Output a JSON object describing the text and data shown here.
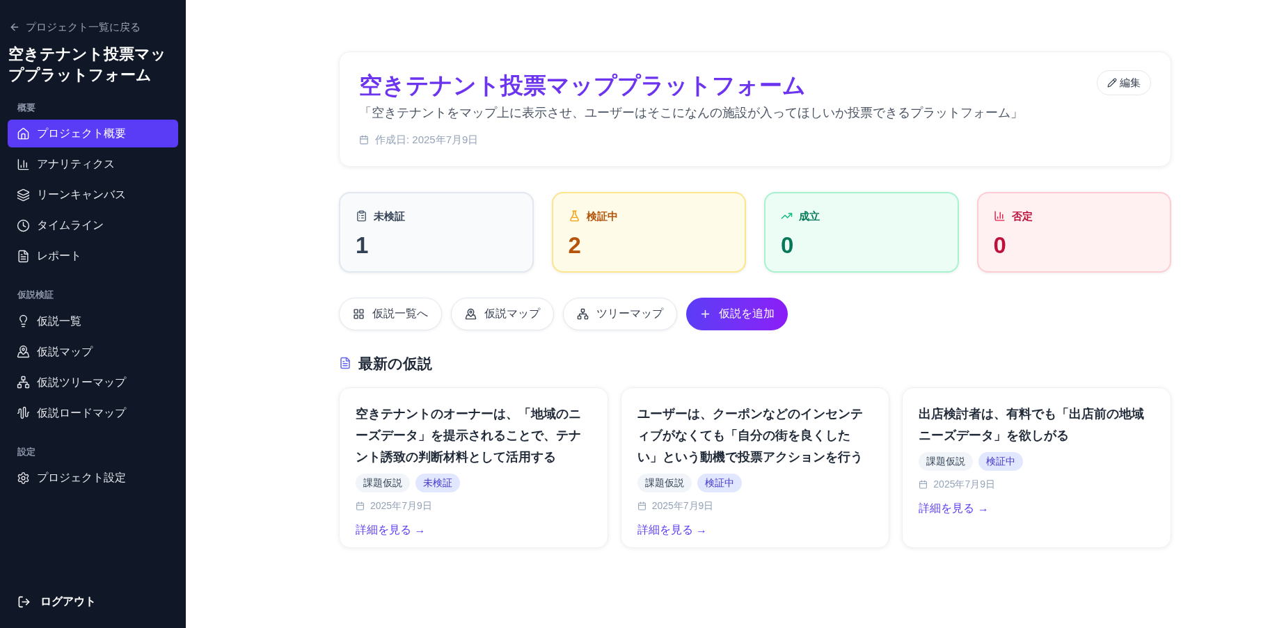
{
  "sidebar": {
    "back_link": "プロジェクト一覧に戻る",
    "project_title": "空きテナント投票マッププラットフォーム",
    "sections": [
      {
        "label": "概要",
        "items": [
          {
            "label": "プロジェクト概要",
            "selected": true
          },
          {
            "label": "アナリティクス",
            "selected": false
          },
          {
            "label": "リーンキャンバス",
            "selected": false
          },
          {
            "label": "タイムライン",
            "selected": false
          },
          {
            "label": "レポート",
            "selected": false
          }
        ]
      },
      {
        "label": "仮説検証",
        "items": [
          {
            "label": "仮説一覧",
            "selected": false
          },
          {
            "label": "仮説マップ",
            "selected": false
          },
          {
            "label": "仮説ツリーマップ",
            "selected": false
          },
          {
            "label": "仮説ロードマップ",
            "selected": false
          }
        ]
      },
      {
        "label": "設定",
        "items": [
          {
            "label": "プロジェクト設定",
            "selected": false
          }
        ]
      }
    ],
    "logout": "ログアウト"
  },
  "project": {
    "title": "空きテナント投票マッププラットフォーム",
    "description": "「空きテナントをマップ上に表示させ、ユーザーはそこになんの施設が入ってほしいか投票できるプラットフォーム」",
    "created": "作成日: 2025年7月9日",
    "edit_button": "編集"
  },
  "stats": [
    {
      "kind": "untested",
      "label": "未検証",
      "count": "1"
    },
    {
      "kind": "testing",
      "label": "検証中",
      "count": "2"
    },
    {
      "kind": "validated",
      "label": "成立",
      "count": "0"
    },
    {
      "kind": "rejected",
      "label": "否定",
      "count": "0"
    }
  ],
  "actions": [
    {
      "kind": "outline",
      "label": "仮説一覧へ"
    },
    {
      "kind": "outline",
      "label": "仮説マップ"
    },
    {
      "kind": "outline",
      "label": "ツリーマップ"
    },
    {
      "kind": "primary",
      "label": "仮説を追加"
    }
  ],
  "latest": {
    "heading": "最新の仮説",
    "cards": [
      {
        "title": "空きテナントのオーナーは、「地域のニーズデータ」を提示されることで、テナント誘致の判断材料として活用する",
        "tags": [
          {
            "kind": "category",
            "label": "課題仮説"
          },
          {
            "kind": "status",
            "label": "未検証"
          }
        ],
        "date": "2025年7月9日",
        "link": "詳細を見る →"
      },
      {
        "title": "ユーザーは、クーポンなどのインセンティブがなくても「自分の街を良くしたい」という動機で投票アクションを行う",
        "tags": [
          {
            "kind": "category",
            "label": "課題仮説"
          },
          {
            "kind": "status",
            "label": "検証中"
          }
        ],
        "date": "2025年7月9日",
        "link": "詳細を見る →"
      },
      {
        "title": "出店検討者は、有料でも「出店前の地域ニーズデータ」を欲しがる",
        "tags": [
          {
            "kind": "category",
            "label": "課題仮説"
          },
          {
            "kind": "status",
            "label": "検証中"
          }
        ],
        "date": "2025年7月9日",
        "link": "詳細を見る →"
      }
    ]
  }
}
